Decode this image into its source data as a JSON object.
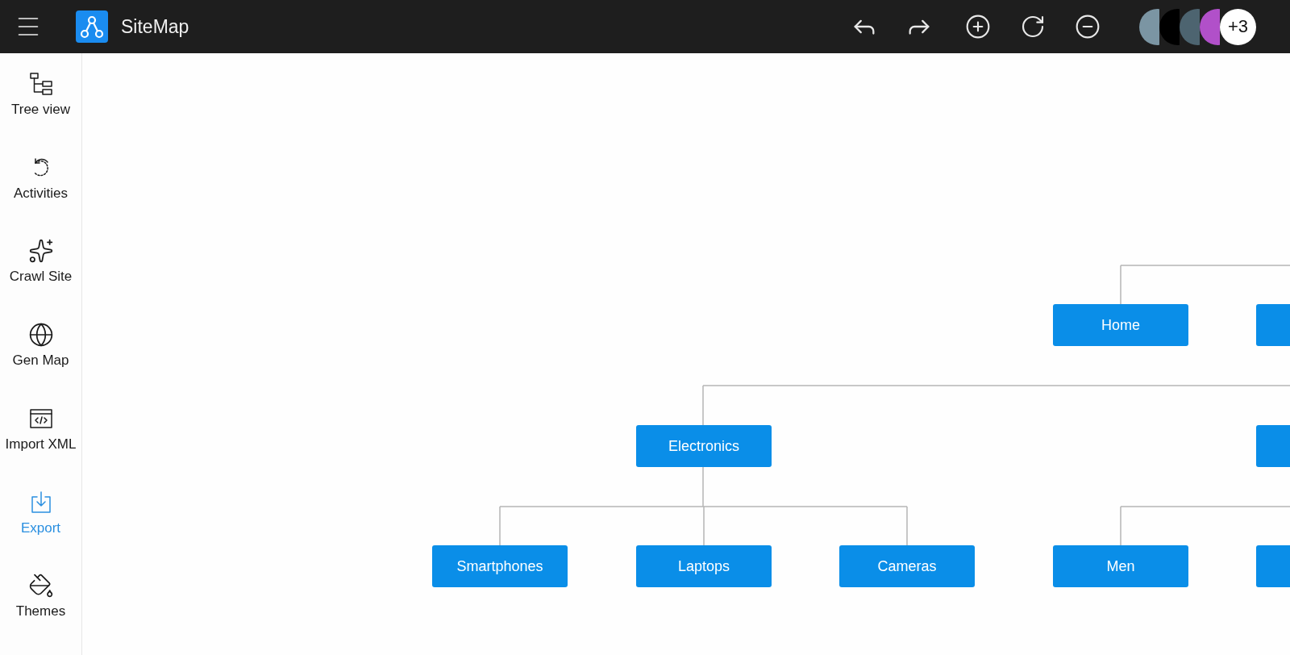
{
  "app": {
    "title": "SiteMap"
  },
  "avatars": [
    {
      "color": "#7b95a3",
      "kind": "plain"
    },
    {
      "kind": "plain",
      "color": "#000000"
    },
    {
      "color": "#4d6470",
      "kind": "plain"
    },
    {
      "color": "#b150c9",
      "kind": "plain"
    },
    {
      "initial": "+3",
      "color": "#ffffff",
      "kind": "count"
    }
  ],
  "sidebar": {
    "items": [
      {
        "label": "Tree view",
        "selected": false,
        "kind": "tree"
      },
      {
        "label": "Activities",
        "selected": false,
        "kind": "activity"
      },
      {
        "label": "Crawl Site",
        "selected": false,
        "kind": "crawl"
      },
      {
        "label": "Gen Map",
        "selected": false,
        "kind": "globe"
      },
      {
        "label": "Import XML",
        "selected": false,
        "kind": "xml"
      },
      {
        "label": "Export",
        "selected": true,
        "kind": "export"
      },
      {
        "label": "Themes",
        "selected": false,
        "kind": "themes"
      }
    ]
  },
  "nodes": [
    {
      "kind": "node",
      "label": "Home"
    },
    {
      "kind": "clipped"
    },
    {
      "kind": "node",
      "label": "Electronics"
    },
    {
      "kind": "clipped"
    },
    {
      "kind": "node",
      "label": "Smartphones"
    },
    {
      "kind": "node",
      "label": "Laptops"
    },
    {
      "kind": "node",
      "label": "Cameras"
    },
    {
      "kind": "node",
      "label": "Men"
    },
    {
      "kind": "clipped"
    }
  ]
}
